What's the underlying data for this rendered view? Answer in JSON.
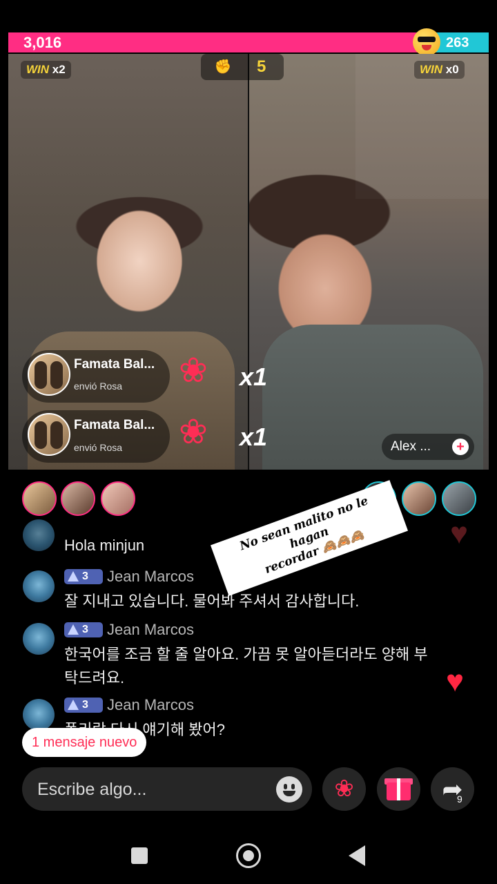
{
  "battle": {
    "score_left": "3,016",
    "score_right": "263",
    "win_left_label": "WIN",
    "win_left_count": "x2",
    "win_right_label": "WIN",
    "win_right_count": "x0",
    "round_count": "5",
    "left_color": "#ff2d83",
    "right_color": "#21c7d6"
  },
  "gifts": [
    {
      "name": "Famata Bal...",
      "action": "envió Rosa",
      "multiplier": "x1",
      "icon": "rose-icon"
    },
    {
      "name": "Famata Bal...",
      "action": "envió Rosa",
      "multiplier": "x1",
      "icon": "rose-icon"
    }
  ],
  "streamer_right": {
    "name": "Alex ..."
  },
  "supporters_left": [
    "3",
    "2",
    "1"
  ],
  "supporters_right": [
    "1",
    "2",
    "3"
  ],
  "chat": {
    "first_message": "Hola minjun",
    "messages": [
      {
        "level": "3",
        "user": "Jean Marcos",
        "lines": [
          "잘 지내고 있습니다. 물어봐 주셔서 감사합니다."
        ]
      },
      {
        "level": "3",
        "user": "Jean Marcos",
        "lines": [
          "한국어를 조금 할 줄 알아요. 가끔 못 알아듣더라도 양해 부",
          "탁드려요."
        ]
      },
      {
        "level": "3",
        "user": "Jean Marcos",
        "lines": [
          "폴리랑 다시 얘기해 봤어?"
        ]
      }
    ],
    "new_messages": "1 mensaje nuevo"
  },
  "sticker": {
    "line1": "No sean malito no le hagan",
    "line2": "recordar 🙈🙈🙈"
  },
  "composer": {
    "placeholder": "Escribe algo...",
    "share_count": "9"
  },
  "icons": [
    "emoji-icon",
    "rose-icon",
    "gift-icon",
    "share-icon",
    "heart-icon",
    "fist-icon"
  ]
}
